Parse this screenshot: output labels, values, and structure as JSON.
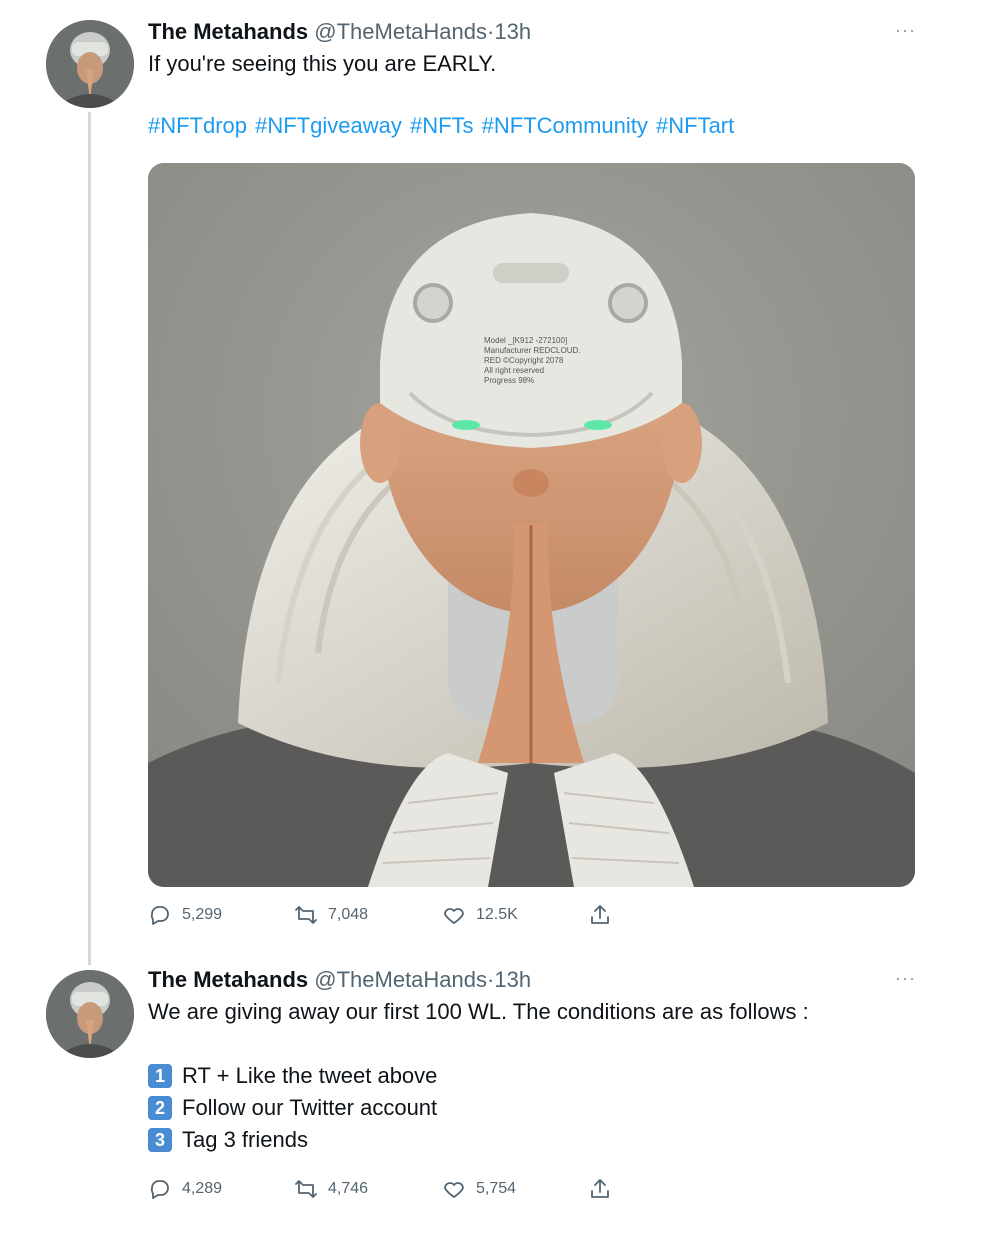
{
  "tweets": [
    {
      "name": "The Metahands",
      "handle": "@TheMetaHands",
      "sep": "·",
      "time": "13h",
      "more": "···",
      "text": "If you're seeing this you are EARLY.",
      "hashtags": "#NFTdrop #NFTgiveaway #NFTs #NFTCommunity #NFTart",
      "media_label": "Model _[K912 -272100] Manufacturer REDCLOUD. RED ©Copyright 2078 All right reserved Progress 98%",
      "replies": "5,299",
      "retweets": "7,048",
      "likes": "12.5K"
    },
    {
      "name": "The Metahands",
      "handle": "@TheMetaHands",
      "sep": "·",
      "time": "13h",
      "more": "···",
      "text": "We are giving away our first 100 WL. The conditions are as follows :",
      "list": [
        {
          "num": "1",
          "label": "RT + Like the tweet above"
        },
        {
          "num": "2",
          "label": "Follow our Twitter account"
        },
        {
          "num": "3",
          "label": "Tag 3 friends"
        }
      ],
      "replies": "4,289",
      "retweets": "4,746",
      "likes": "5,754"
    }
  ],
  "icons": [
    "reply-icon",
    "retweet-icon",
    "like-icon",
    "share-icon",
    "more-icon"
  ],
  "colors": {
    "link": "#1d9bf0",
    "secondary": "#536471",
    "thread": "#cfd9de",
    "keycap": "#4a8cd2"
  }
}
